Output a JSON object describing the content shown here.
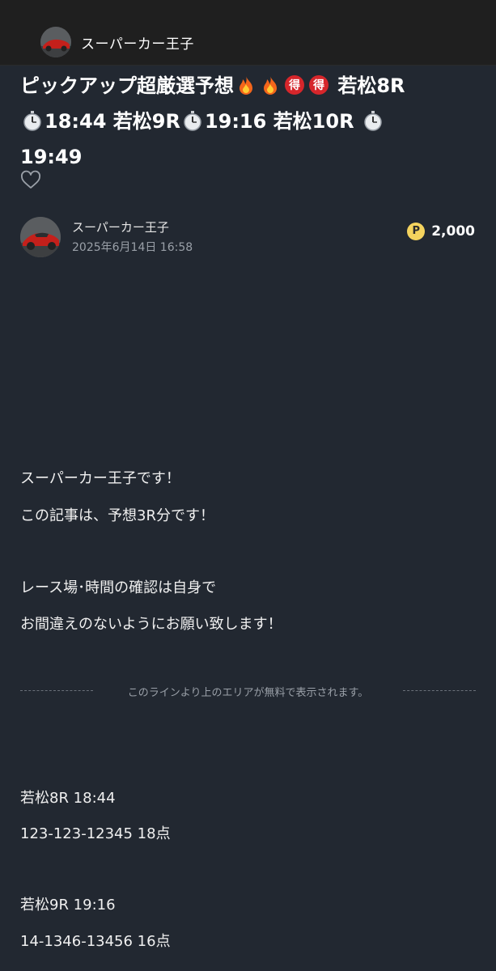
{
  "header": {
    "account_name": "スーパーカー王子"
  },
  "article": {
    "title_line1": "ピックアップ超厳選予想",
    "title_line1b": "若松8R",
    "title_line2a": "18:44 若松9R",
    "title_line2b": "19:16 若松10R",
    "title_line3": "19:49",
    "emoji_fire": "fire-emoji",
    "emoji_toku": "得",
    "emoji_stopwatch": "stopwatch-emoji"
  },
  "author": {
    "name": "スーパーカー王子",
    "date": "2025年6月14日 16:58"
  },
  "price": {
    "coin_symbol": "P",
    "value": "2,000"
  },
  "content": {
    "intro1": "スーパーカー王子です！",
    "intro2": "この記事は、予想3R分です！",
    "note1": "レース場･時間の確認は自身で",
    "note2": "お間違えのないようにお願い致します！",
    "paywall_notice": "このラインより上のエリアが無料で表示されます。",
    "race1_title": "若松8R 18:44",
    "race1_pick": "123-123-12345 18点",
    "race2_title": "若松9R 19:16",
    "race2_pick": "14-1346-13456 16点"
  },
  "colors": {
    "background": "#222831",
    "top_bar": "#1f1f1f",
    "coin": "#f4d35e"
  }
}
